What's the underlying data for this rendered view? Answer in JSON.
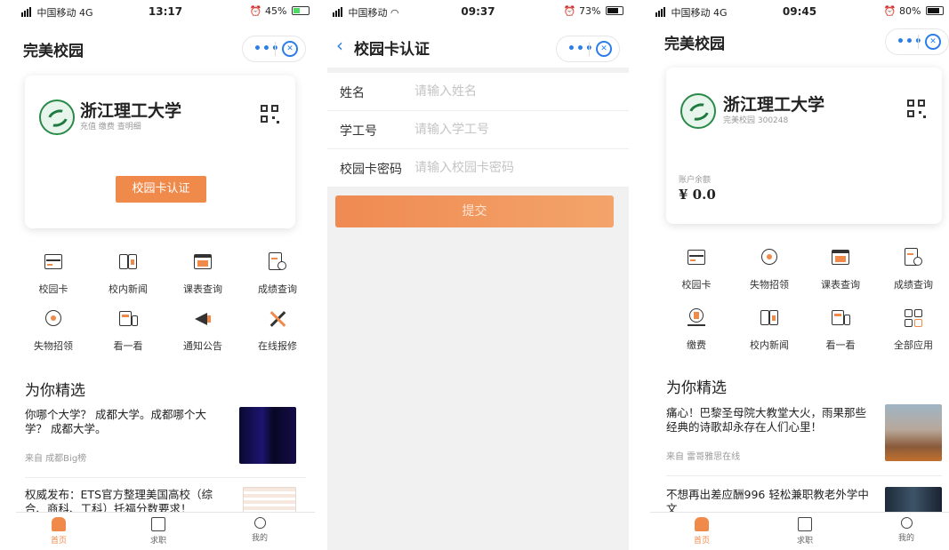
{
  "screen1": {
    "status": {
      "carrier": "中国移动",
      "network": "4G",
      "time": "13:17",
      "battery": "45%"
    },
    "title": "完美校园",
    "card": {
      "name": "浙江理工大学",
      "sub": "充值 缴费 查明细",
      "button": "校园卡认证"
    },
    "grid": [
      {
        "label": "校园卡",
        "icon": "card-icon"
      },
      {
        "label": "校内新闻",
        "icon": "news-icon"
      },
      {
        "label": "课表查询",
        "icon": "calendar-icon"
      },
      {
        "label": "成绩查询",
        "icon": "grade-icon"
      },
      {
        "label": "失物招领",
        "icon": "lost-found-icon"
      },
      {
        "label": "看一看",
        "icon": "look-icon"
      },
      {
        "label": "通知公告",
        "icon": "megaphone-icon"
      },
      {
        "label": "在线报修",
        "icon": "repair-icon"
      }
    ],
    "section": "为你精选",
    "feed": [
      {
        "title": "你哪个大学？ 成都大学。成都哪个大学？ 成都大学。",
        "source": "来自 成都Big榜"
      },
      {
        "title": "权威发布：ETS官方整理美国高校（综合、商科、工科）托福分数要求！",
        "source": ""
      }
    ],
    "tabs": [
      "首页",
      "求职",
      "我的"
    ]
  },
  "screen2": {
    "status": {
      "carrier": "中国移动",
      "time": "09:37",
      "battery": "73%"
    },
    "title": "校园卡认证",
    "fields": [
      {
        "label": "姓名",
        "placeholder": "请输入姓名"
      },
      {
        "label": "学工号",
        "placeholder": "请输入学工号"
      },
      {
        "label": "校园卡密码",
        "placeholder": "请输入校园卡密码"
      }
    ],
    "submit": "提交"
  },
  "screen3": {
    "status": {
      "carrier": "中国移动",
      "network": "4G",
      "time": "09:45",
      "battery": "80%"
    },
    "title": "完美校园",
    "card": {
      "name": "浙江理工大学",
      "sub": "完美校园 300248",
      "balance_label": "账户余额",
      "balance": "¥ 0.0"
    },
    "grid": [
      {
        "label": "校园卡",
        "icon": "card-icon"
      },
      {
        "label": "失物招领",
        "icon": "lost-found-icon"
      },
      {
        "label": "课表查询",
        "icon": "calendar-icon"
      },
      {
        "label": "成绩查询",
        "icon": "grade-icon"
      },
      {
        "label": "缴费",
        "icon": "payment-icon"
      },
      {
        "label": "校内新闻",
        "icon": "news-icon"
      },
      {
        "label": "看一看",
        "icon": "look-icon"
      },
      {
        "label": "全部应用",
        "icon": "all-apps-icon"
      }
    ],
    "section": "为你精选",
    "feed": [
      {
        "title": "痛心！巴黎圣母院大教堂大火，雨果那些经典的诗歌却永存在人们心里！",
        "source": "来自 雷哥雅思在线"
      },
      {
        "title": "不想再出差应酬996 轻松兼职教老外学中文",
        "source": ""
      }
    ],
    "tabs": [
      "首页",
      "求职",
      "我的"
    ]
  }
}
